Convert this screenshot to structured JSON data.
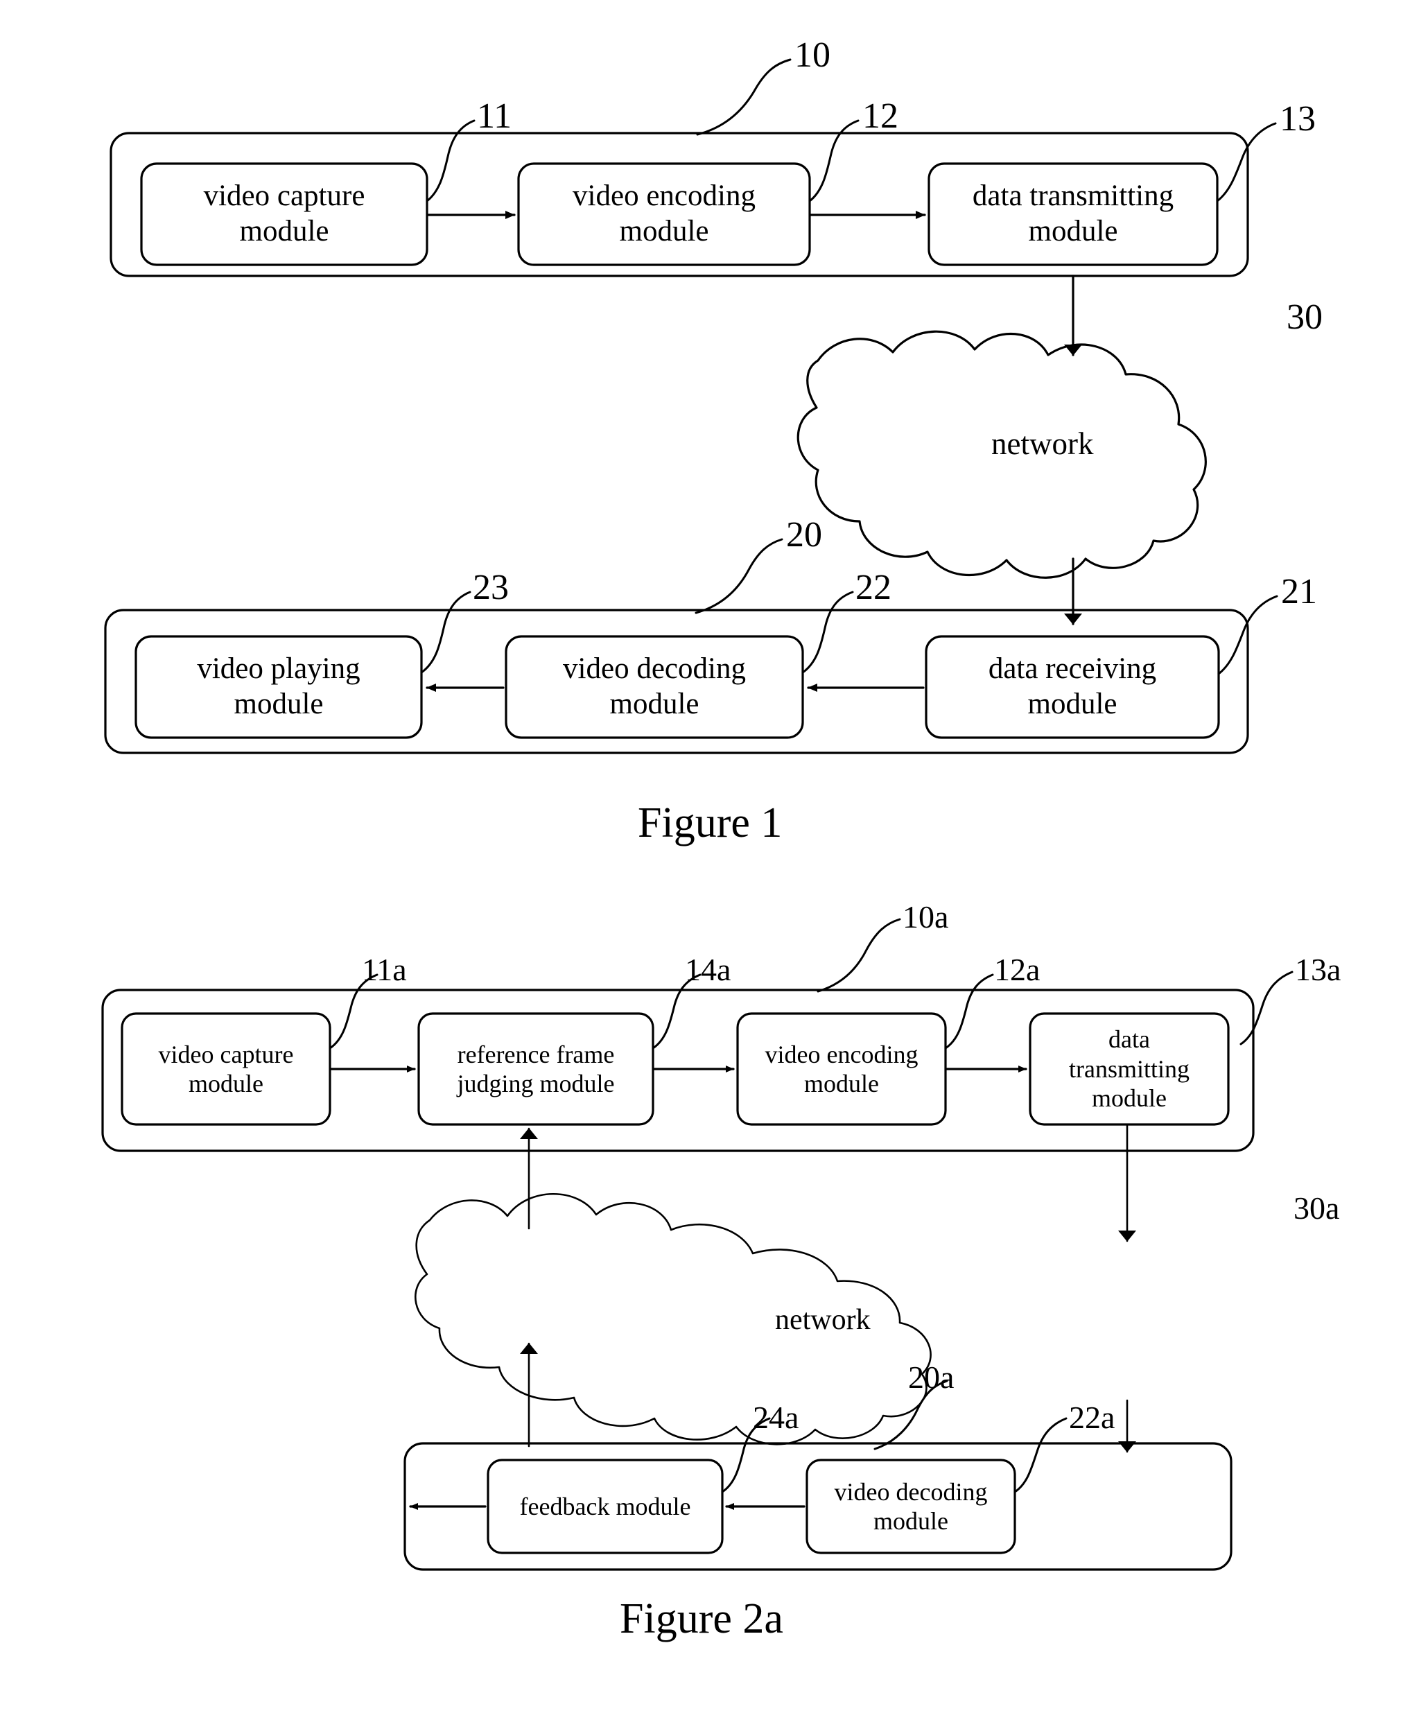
{
  "document": {
    "type": "patent-drawing-sheet",
    "background_color": "#ffffff",
    "line_color": "#000000"
  },
  "figure1": {
    "caption": "Figure 1",
    "sender": {
      "ref": "10",
      "modules": [
        {
          "ref": "11",
          "label": "video capture\nmodule"
        },
        {
          "ref": "12",
          "label": "video encoding\nmodule"
        },
        {
          "ref": "13",
          "label": "data transmitting\nmodule"
        }
      ]
    },
    "network": {
      "ref": "30",
      "label": "network"
    },
    "receiver": {
      "ref": "20",
      "modules": [
        {
          "ref": "23",
          "label": "video playing\nmodule"
        },
        {
          "ref": "22",
          "label": "video decoding\nmodule"
        },
        {
          "ref": "21",
          "label": "data receiving\nmodule"
        }
      ]
    }
  },
  "figure2a": {
    "caption": "Figure 2a",
    "sender": {
      "ref": "10a",
      "modules": [
        {
          "ref": "11a",
          "label": "video capture\nmodule"
        },
        {
          "ref": "14a",
          "label": "reference frame\njudging module"
        },
        {
          "ref": "12a",
          "label": "video encoding\nmodule"
        },
        {
          "ref": "13a",
          "label": "data\ntransmitting\nmodule"
        }
      ]
    },
    "network": {
      "ref": "30a",
      "label": "network"
    },
    "receiver": {
      "ref": "20a",
      "modules": [
        {
          "ref": "24a",
          "label": "feedback module"
        },
        {
          "ref": "22a",
          "label": "video decoding\nmodule"
        }
      ]
    }
  }
}
